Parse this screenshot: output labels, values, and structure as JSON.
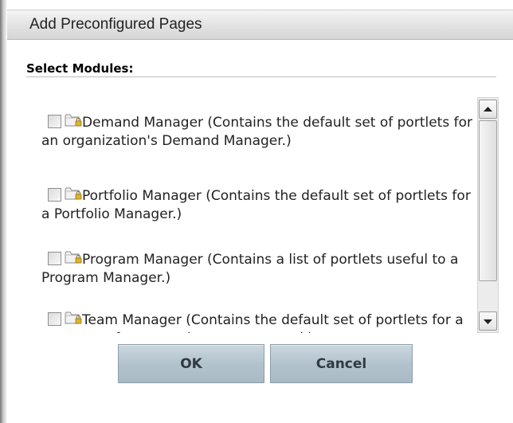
{
  "dialog": {
    "title": "Add Preconfigured Pages",
    "section_label": "Select Modules:"
  },
  "modules": [
    {
      "label": "Demand Manager (Contains the default set of portlets for an organization's Demand Manager.)",
      "checked": false
    },
    {
      "label": "Portfolio Manager (Contains the default set of portlets for a Portfolio Manager.)",
      "checked": false
    },
    {
      "label": "Program Manager (Contains a list of portlets useful to a Program Manager.)",
      "checked": false
    },
    {
      "label": "Team Manager (Contains the default set of portlets for a manager of a team who manages work)",
      "checked": false
    }
  ],
  "icons": {
    "module_icon": "locked-folder-icon",
    "scroll_up": "arrow-up-icon",
    "scroll_down": "arrow-down-icon"
  },
  "buttons": {
    "ok": "OK",
    "cancel": "Cancel"
  },
  "colors": {
    "button_bg": "#b3c3cd",
    "titlebar_bg": "#e2e2e2"
  }
}
